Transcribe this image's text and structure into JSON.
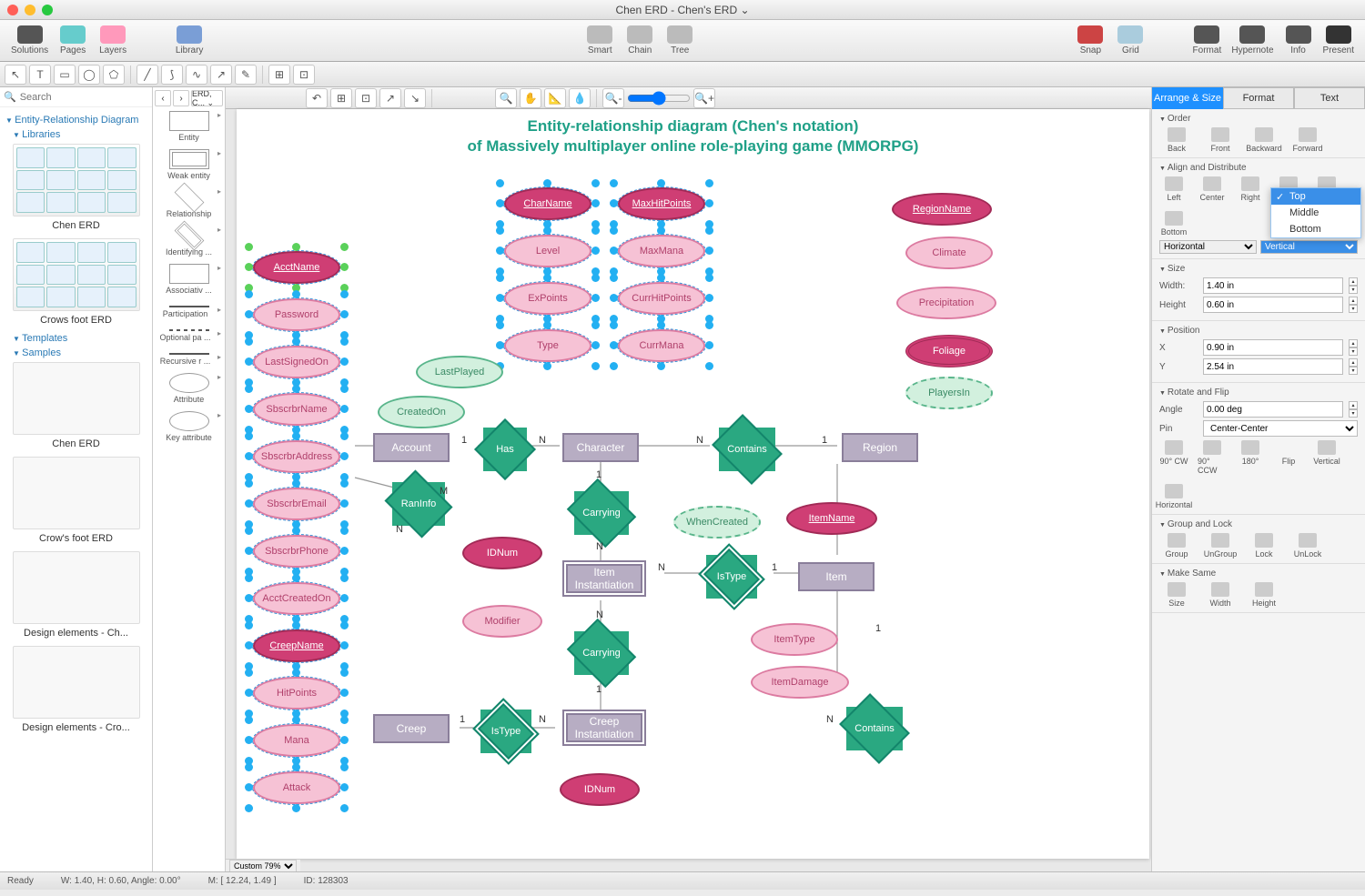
{
  "window": {
    "title": "Chen ERD - Chen's ERD ⌄"
  },
  "toolbar": {
    "left": [
      "Solutions",
      "Pages",
      "Layers"
    ],
    "library": "Library",
    "center": [
      "Smart",
      "Chain",
      "Tree"
    ],
    "right1": [
      "Snap",
      "Grid"
    ],
    "right2": [
      "Format",
      "Hypernote",
      "Info",
      "Present"
    ]
  },
  "search": {
    "placeholder": "Search"
  },
  "tree": {
    "root": "Entity-Relationship Diagram",
    "libraries": "Libraries",
    "chenerd": "Chen ERD",
    "crowsfoot": "Crows foot ERD",
    "templates": "Templates",
    "samples": "Samples",
    "s1": "Chen ERD",
    "s2": "Crow's foot ERD",
    "s3": "Design elements - Ch...",
    "s4": "Design elements - Cro..."
  },
  "libnav": {
    "bc": "ERD, C... ⌄"
  },
  "lib": {
    "entity": "Entity",
    "weak": "Weak entity",
    "relationship": "Relationship",
    "ident": "Identifying ...",
    "assoc": "Associativ ...",
    "part": "Participation",
    "optpart": "Optional pa ...",
    "recur": "Recursive r ...",
    "attribute": "Attribute",
    "keyattr": "Key attribute"
  },
  "diagram": {
    "title_l1": "Entity-relationship diagram (Chen's notation)",
    "title_l2": "of Massively multiplayer online role-playing game (MMORPG)",
    "selected_col1": [
      "AcctName",
      "Password",
      "LastSignedOn",
      "SbscrbrName",
      "SbscrbrAddress",
      "SbscrbrEmail",
      "SbscrbrPhone",
      "AcctCreatedOn",
      "CreepName",
      "HitPoints",
      "Mana",
      "Attack"
    ],
    "selected_col2": [
      "CharName",
      "Level",
      "ExPoints",
      "Type"
    ],
    "selected_col3": [
      "MaxHitPoints",
      "MaxMana",
      "CurrHitPoints",
      "CurrMana"
    ],
    "greens": {
      "lastplayed": "LastPlayed",
      "createdon": "CreatedOn",
      "whencreated": "WhenCreated",
      "playersin": "PlayersIn"
    },
    "rightattrs": [
      "RegionName",
      "Climate",
      "Precipitation",
      "Foliage"
    ],
    "entities": {
      "account": "Account",
      "character": "Character",
      "region": "Region",
      "item": "Item",
      "iteminst": "Item Instantiation",
      "creep": "Creep",
      "creepinst": "Creep Instantiation"
    },
    "rels": {
      "has": "Has",
      "contains": "Contains",
      "raninfo": "RanInfo",
      "carrying": "Carrying",
      "carrying2": "Carrying",
      "istype": "IsType",
      "istype2": "IsType",
      "contains2": "Contains"
    },
    "bottomattrs": {
      "idnum": "IDNum",
      "modifier": "Modifier",
      "itemname": "ItemName",
      "itemtype": "ItemType",
      "itemdamage": "ItemDamage",
      "idnum2": "IDNum"
    },
    "cards": {
      "one": "1",
      "n": "N",
      "m": "M"
    }
  },
  "inspector": {
    "tabs": [
      "Arrange & Size",
      "Format",
      "Text"
    ],
    "order": {
      "h": "Order",
      "btns": [
        "Back",
        "Front",
        "Backward",
        "Forward"
      ]
    },
    "align": {
      "h": "Align and Distribute",
      "btns": [
        "Left",
        "Center",
        "Right",
        "Top",
        "Middle",
        "Bottom"
      ],
      "hsel": "Horizontal",
      "vsel": "Vertical",
      "menu": [
        "Top",
        "Middle",
        "Bottom"
      ]
    },
    "size": {
      "h": "Size",
      "wl": "Width:",
      "wv": "1.40 in",
      "hl": "Height",
      "hv": "0.60 in"
    },
    "pos": {
      "h": "Position",
      "xl": "X",
      "xv": "0.90 in",
      "yl": "Y",
      "yv": "2.54 in"
    },
    "rot": {
      "h": "Rotate and Flip",
      "al": "Angle",
      "av": "0.00 deg",
      "pl": "Pin",
      "pv": "Center-Center",
      "btns": [
        "90° CW",
        "90° CCW",
        "180°"
      ],
      "flip": "Flip",
      "flipb": [
        "Vertical",
        "Horizontal"
      ]
    },
    "group": {
      "h": "Group and Lock",
      "btns": [
        "Group",
        "UnGroup",
        "Lock",
        "UnLock"
      ]
    },
    "same": {
      "h": "Make Same",
      "btns": [
        "Size",
        "Width",
        "Height"
      ]
    }
  },
  "zoom": "Custom 79%",
  "status": {
    "ready": "Ready",
    "wh": "W: 1.40, H: 0.60, Angle: 0.00°",
    "m": "M: [ 12.24, 1.49 ]",
    "id": "ID: 128303"
  }
}
